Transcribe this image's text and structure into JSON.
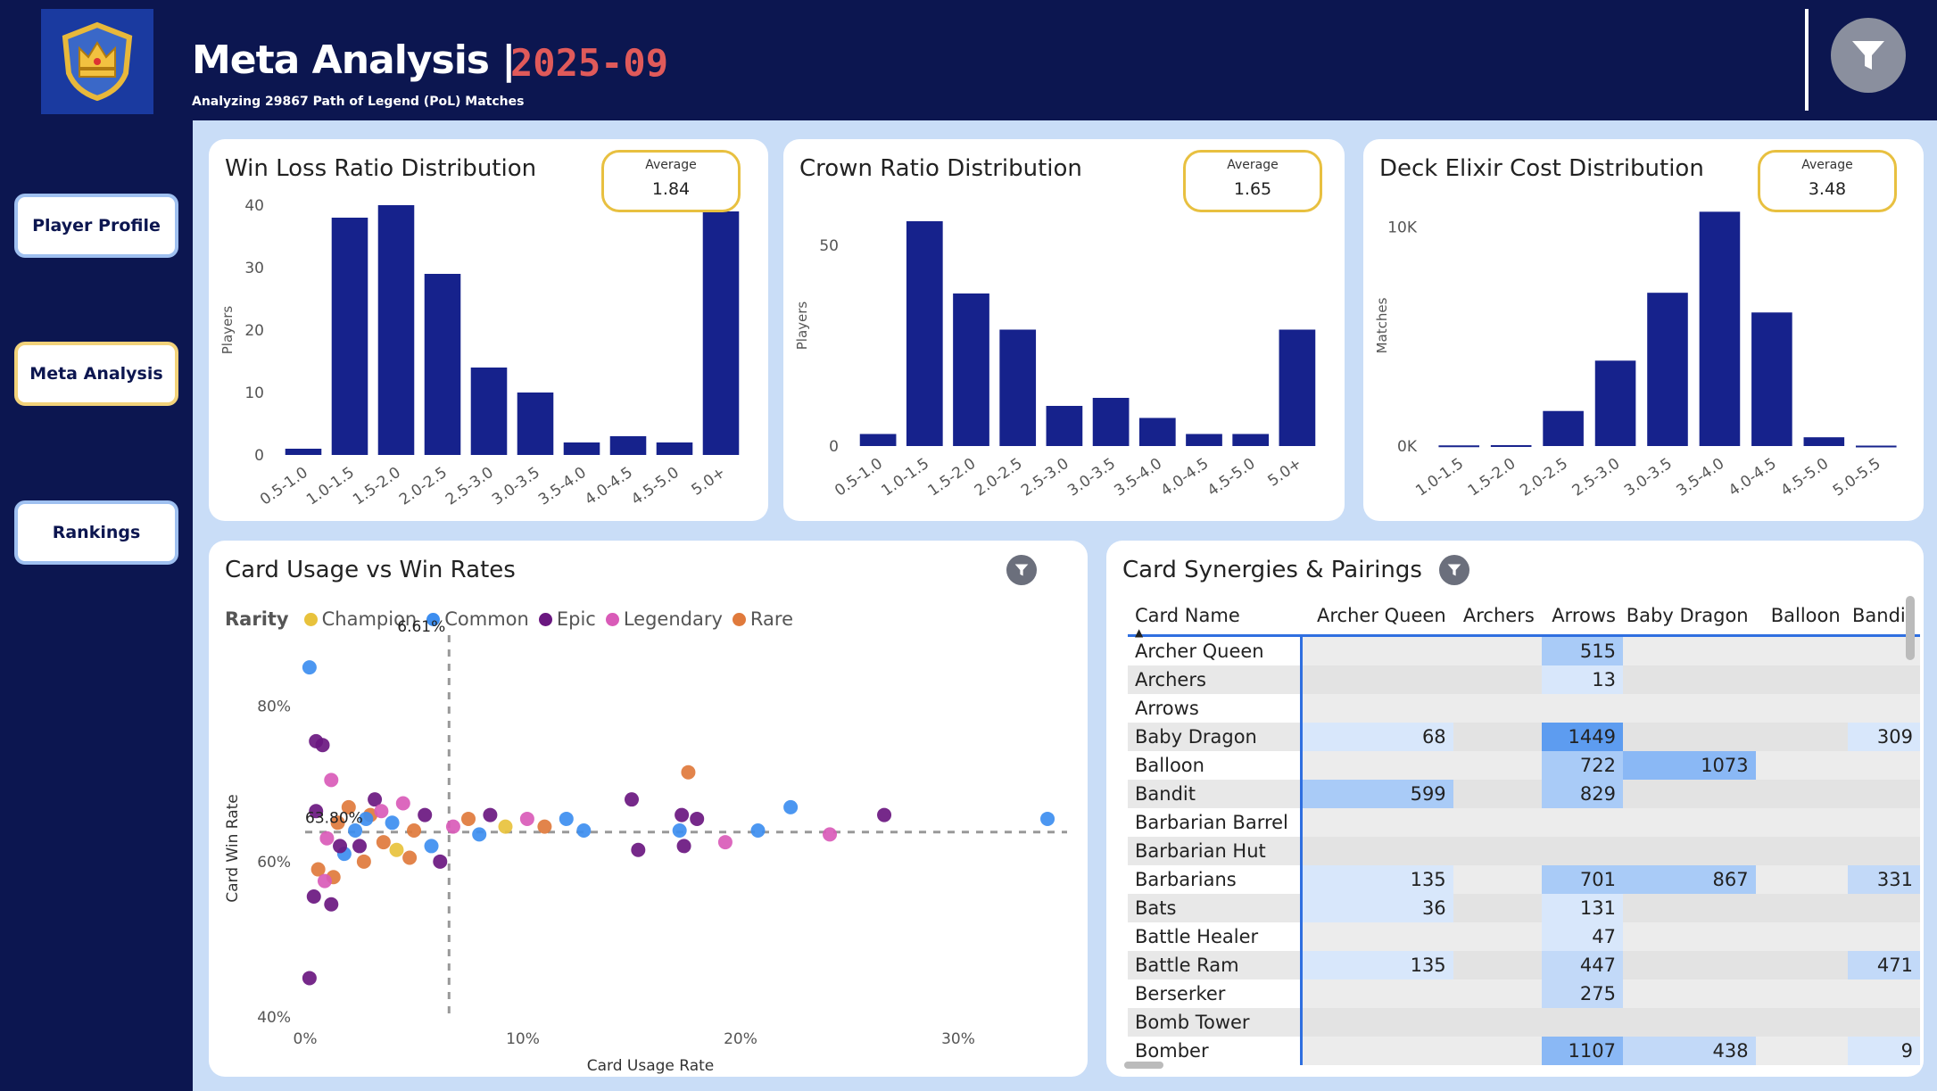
{
  "header": {
    "title": "Meta Analysis |",
    "date": "2025-09",
    "subtitle": "Analyzing 29867 Path of Legend (PoL) Matches"
  },
  "colors": {
    "navy": "#0c1650",
    "bar": "#16228c",
    "accent_red": "#e05a5a",
    "avg_border": "#e8c040"
  },
  "icons": [
    "crown-logo-icon",
    "filter-icon"
  ],
  "nav": {
    "player_profile": "Player Profile",
    "meta_analysis": "Meta Analysis",
    "rankings": "Rankings"
  },
  "charts": {
    "wlr": {
      "title": "Win Loss Ratio Distribution",
      "avg_label": "Average",
      "avg_value": "1.84",
      "ylabel": "Players"
    },
    "crown": {
      "title": "Crown Ratio Distribution",
      "avg_label": "Average",
      "avg_value": "1.65",
      "ylabel": "Players"
    },
    "elixir": {
      "title": "Deck Elixir Cost Distribution",
      "avg_label": "Average",
      "avg_value": "3.48",
      "ylabel": "Matches"
    },
    "usage": {
      "title": "Card Usage vs Win Rates",
      "legend_title": "Rarity",
      "legend": [
        {
          "name": "Champion",
          "color": "#e8c23c"
        },
        {
          "name": "Common",
          "color": "#3d8ef0"
        },
        {
          "name": "Epic",
          "color": "#6a1780"
        },
        {
          "name": "Legendary",
          "color": "#d95bb8"
        },
        {
          "name": "Rare",
          "color": "#e07a3c"
        }
      ],
      "xlabel": "Card Usage Rate",
      "ylabel": "Card Win Rate",
      "ref_x_label": "6.61%",
      "ref_y_label": "63.80%"
    }
  },
  "chart_data": [
    {
      "type": "bar",
      "title": "Win Loss Ratio Distribution",
      "ylabel": "Players",
      "categories": [
        "0.5-1.0",
        "1.0-1.5",
        "1.5-2.0",
        "2.0-2.5",
        "2.5-3.0",
        "3.0-3.5",
        "3.5-4.0",
        "4.0-4.5",
        "4.5-5.0",
        "5.0+"
      ],
      "values": [
        1,
        38,
        40,
        29,
        14,
        10,
        2,
        3,
        2,
        39
      ],
      "ylim": [
        0,
        40
      ],
      "yticks": [
        0,
        10,
        20,
        30,
        40
      ]
    },
    {
      "type": "bar",
      "title": "Crown Ratio Distribution",
      "ylabel": "Players",
      "categories": [
        "0.5-1.0",
        "1.0-1.5",
        "1.5-2.0",
        "2.0-2.5",
        "2.5-3.0",
        "3.0-3.5",
        "3.5-4.0",
        "4.0-4.5",
        "4.5-5.0",
        "5.0+"
      ],
      "values": [
        3,
        56,
        38,
        29,
        10,
        12,
        7,
        3,
        3,
        29
      ],
      "ylim": [
        0,
        60
      ],
      "yticks": [
        0,
        50
      ],
      "ytick_labels": [
        "0",
        "50"
      ]
    },
    {
      "type": "bar",
      "title": "Deck Elixir Cost Distribution",
      "ylabel": "Matches",
      "categories": [
        "1.0-1.5",
        "1.5-2.0",
        "2.0-2.5",
        "2.5-3.0",
        "3.0-3.5",
        "3.5-4.0",
        "4.0-4.5",
        "4.5-5.0",
        "5.0-5.5"
      ],
      "values": [
        30,
        40,
        1600,
        3900,
        7000,
        10700,
        6100,
        400,
        20
      ],
      "ylim": [
        0,
        11000
      ],
      "yticks": [
        0,
        10000
      ],
      "ytick_labels": [
        "0K",
        "10K"
      ]
    },
    {
      "type": "scatter",
      "title": "Card Usage vs Win Rates",
      "xlabel": "Card Usage Rate",
      "ylabel": "Card Win Rate",
      "xlim": [
        0,
        35
      ],
      "ylim": [
        40,
        88
      ],
      "xticks": [
        0,
        10,
        20,
        30
      ],
      "xtick_labels": [
        "0%",
        "10%",
        "20%",
        "30%"
      ],
      "yticks": [
        40,
        60,
        80
      ],
      "ytick_labels": [
        "40%",
        "60%",
        "80%"
      ],
      "reference_lines": {
        "x": 6.61,
        "y": 63.8
      },
      "points": [
        {
          "x": 0.2,
          "y": 85.0,
          "r": "Common"
        },
        {
          "x": 0.5,
          "y": 75.5,
          "r": "Epic"
        },
        {
          "x": 0.8,
          "y": 75.0,
          "r": "Epic"
        },
        {
          "x": 0.2,
          "y": 45.0,
          "r": "Epic"
        },
        {
          "x": 1.2,
          "y": 70.5,
          "r": "Legendary"
        },
        {
          "x": 0.4,
          "y": 55.5,
          "r": "Epic"
        },
        {
          "x": 1.2,
          "y": 54.5,
          "r": "Epic"
        },
        {
          "x": 1.3,
          "y": 58.0,
          "r": "Rare"
        },
        {
          "x": 0.6,
          "y": 59.0,
          "r": "Rare"
        },
        {
          "x": 1.8,
          "y": 61.0,
          "r": "Common"
        },
        {
          "x": 2.7,
          "y": 60.0,
          "r": "Rare"
        },
        {
          "x": 0.5,
          "y": 66.5,
          "r": "Epic"
        },
        {
          "x": 1.0,
          "y": 63.0,
          "r": "Legendary"
        },
        {
          "x": 1.5,
          "y": 65.0,
          "r": "Rare"
        },
        {
          "x": 2.0,
          "y": 67.0,
          "r": "Rare"
        },
        {
          "x": 2.3,
          "y": 64.0,
          "r": "Common"
        },
        {
          "x": 2.5,
          "y": 62.0,
          "r": "Epic"
        },
        {
          "x": 3.0,
          "y": 66.0,
          "r": "Rare"
        },
        {
          "x": 3.2,
          "y": 68.0,
          "r": "Epic"
        },
        {
          "x": 3.6,
          "y": 62.5,
          "r": "Rare"
        },
        {
          "x": 4.0,
          "y": 65.0,
          "r": "Common"
        },
        {
          "x": 4.2,
          "y": 61.5,
          "r": "Champion"
        },
        {
          "x": 4.5,
          "y": 67.5,
          "r": "Legendary"
        },
        {
          "x": 5.0,
          "y": 64.0,
          "r": "Rare"
        },
        {
          "x": 5.5,
          "y": 66.0,
          "r": "Epic"
        },
        {
          "x": 5.8,
          "y": 62.0,
          "r": "Common"
        },
        {
          "x": 6.2,
          "y": 60.0,
          "r": "Epic"
        },
        {
          "x": 6.8,
          "y": 64.5,
          "r": "Legendary"
        },
        {
          "x": 7.5,
          "y": 65.5,
          "r": "Rare"
        },
        {
          "x": 8.0,
          "y": 63.5,
          "r": "Common"
        },
        {
          "x": 8.5,
          "y": 66.0,
          "r": "Epic"
        },
        {
          "x": 9.2,
          "y": 64.5,
          "r": "Champion"
        },
        {
          "x": 10.2,
          "y": 65.5,
          "r": "Legendary"
        },
        {
          "x": 11.0,
          "y": 64.5,
          "r": "Rare"
        },
        {
          "x": 12.0,
          "y": 65.5,
          "r": "Common"
        },
        {
          "x": 12.8,
          "y": 64.0,
          "r": "Common"
        },
        {
          "x": 15.0,
          "y": 68.0,
          "r": "Epic"
        },
        {
          "x": 15.3,
          "y": 61.5,
          "r": "Epic"
        },
        {
          "x": 17.2,
          "y": 64.0,
          "r": "Common"
        },
        {
          "x": 17.3,
          "y": 66.0,
          "r": "Epic"
        },
        {
          "x": 17.4,
          "y": 62.0,
          "r": "Epic"
        },
        {
          "x": 17.6,
          "y": 71.5,
          "r": "Rare"
        },
        {
          "x": 18.0,
          "y": 65.5,
          "r": "Epic"
        },
        {
          "x": 19.3,
          "y": 62.5,
          "r": "Legendary"
        },
        {
          "x": 20.8,
          "y": 64.0,
          "r": "Common"
        },
        {
          "x": 22.3,
          "y": 67.0,
          "r": "Common"
        },
        {
          "x": 24.1,
          "y": 63.5,
          "r": "Legendary"
        },
        {
          "x": 26.6,
          "y": 66.0,
          "r": "Epic"
        },
        {
          "x": 34.1,
          "y": 65.5,
          "r": "Common"
        },
        {
          "x": 2.8,
          "y": 65.5,
          "r": "Common"
        },
        {
          "x": 3.5,
          "y": 66.5,
          "r": "Legendary"
        },
        {
          "x": 1.6,
          "y": 62.0,
          "r": "Epic"
        },
        {
          "x": 0.9,
          "y": 57.5,
          "r": "Legendary"
        },
        {
          "x": 4.8,
          "y": 60.5,
          "r": "Rare"
        }
      ]
    }
  ],
  "matrix": {
    "title": "Card Synergies & Pairings",
    "row_header": "Card Name",
    "columns": [
      "Archer Queen",
      "Archers",
      "Arrows",
      "Baby Dragon",
      "Balloon",
      "Bandit"
    ],
    "rows": [
      {
        "name": "Archer Queen",
        "vals": [
          "",
          "",
          "515",
          "",
          "",
          ""
        ],
        "lv": [
          0,
          0,
          1,
          0,
          0,
          0
        ]
      },
      {
        "name": "Archers",
        "vals": [
          "",
          "",
          "13",
          "",
          "",
          ""
        ],
        "lv": [
          0,
          0,
          0.3,
          0,
          0,
          0
        ]
      },
      {
        "name": "Arrows",
        "vals": [
          "",
          "",
          "",
          "",
          "",
          ""
        ],
        "lv": [
          0,
          0,
          0,
          0,
          0,
          0
        ]
      },
      {
        "name": "Baby Dragon",
        "vals": [
          "68",
          "",
          "1449",
          "",
          "",
          "309"
        ],
        "lv": [
          0.3,
          0,
          2,
          0,
          0,
          0.4
        ]
      },
      {
        "name": "Balloon",
        "vals": [
          "",
          "",
          "722",
          "1073",
          "",
          ""
        ],
        "lv": [
          0,
          0,
          1,
          1.5,
          0,
          0
        ]
      },
      {
        "name": "Bandit",
        "vals": [
          "599",
          "",
          "829",
          "",
          "",
          ""
        ],
        "lv": [
          0.9,
          0,
          1,
          0,
          0,
          0
        ]
      },
      {
        "name": "Barbarian Barrel",
        "vals": [
          "",
          "",
          "",
          "",
          "",
          ""
        ],
        "lv": [
          0,
          0,
          0,
          0,
          0,
          0
        ]
      },
      {
        "name": "Barbarian Hut",
        "vals": [
          "",
          "",
          "",
          "",
          "",
          ""
        ],
        "lv": [
          0,
          0,
          0,
          0,
          0,
          0
        ]
      },
      {
        "name": "Barbarians",
        "vals": [
          "135",
          "",
          "701",
          "867",
          "",
          "331"
        ],
        "lv": [
          0.4,
          0,
          1,
          1.1,
          0,
          0.5
        ]
      },
      {
        "name": "Bats",
        "vals": [
          "36",
          "",
          "131",
          "",
          "",
          ""
        ],
        "lv": [
          0.3,
          0,
          0.4,
          0,
          0,
          0
        ]
      },
      {
        "name": "Battle Healer",
        "vals": [
          "",
          "",
          "47",
          "",
          "",
          ""
        ],
        "lv": [
          0,
          0,
          0.3,
          0,
          0,
          0
        ]
      },
      {
        "name": "Battle Ram",
        "vals": [
          "135",
          "",
          "447",
          "",
          "",
          "471"
        ],
        "lv": [
          0.4,
          0,
          0.7,
          0,
          0,
          0.7
        ]
      },
      {
        "name": "Berserker",
        "vals": [
          "",
          "",
          "275",
          "",
          "",
          ""
        ],
        "lv": [
          0,
          0,
          0.5,
          0,
          0,
          0
        ]
      },
      {
        "name": "Bomb Tower",
        "vals": [
          "",
          "",
          "",
          "",
          "",
          ""
        ],
        "lv": [
          0,
          0,
          0,
          0,
          0,
          0
        ]
      },
      {
        "name": "Bomber",
        "vals": [
          "",
          "",
          "1107",
          "438",
          "",
          "9"
        ],
        "lv": [
          0,
          0,
          1.5,
          0.6,
          0,
          0.2
        ]
      }
    ]
  }
}
